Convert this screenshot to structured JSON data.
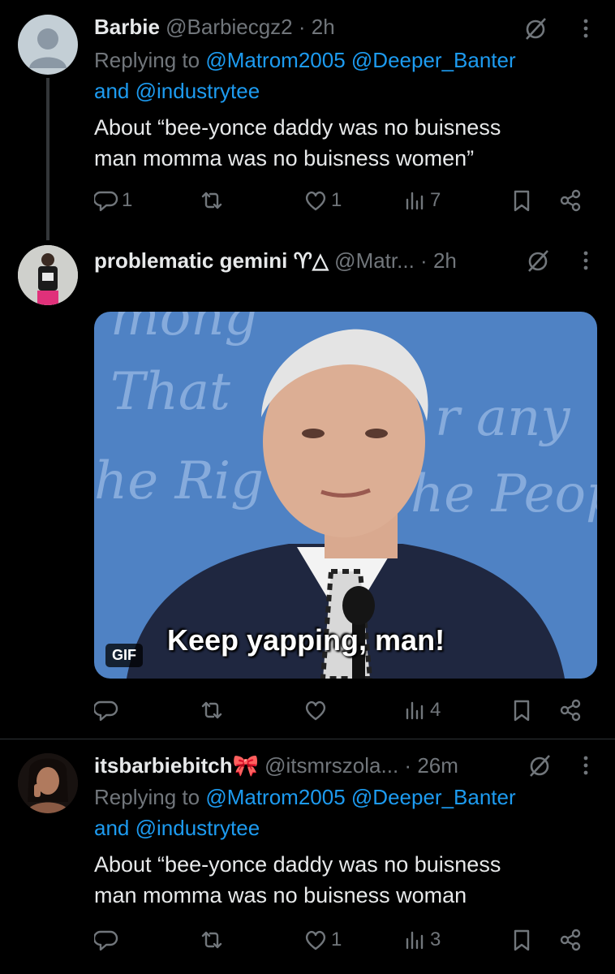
{
  "tweets": [
    {
      "name": "Barbie",
      "handle": "@Barbiecgz2",
      "sep": "·",
      "time": "2h",
      "replying_prefix": "Replying to",
      "reply_user1": "@Matrom2005",
      "reply_user2": "@Deeper_Banter",
      "reply_and": "and",
      "reply_user3": "@industrytee",
      "text_line1": "About “bee-yonce daddy was no buisness",
      "text_line2": "man momma was no buisness women”",
      "replies": "1",
      "retweets": "",
      "likes": "1",
      "views": "7"
    },
    {
      "name": "problematic gemini",
      "name_emoji": "♈︎△",
      "handle": "@Matr...",
      "sep": "·",
      "time": "2h",
      "gif_label": "GIF",
      "gif_caption": "Keep yapping, man!",
      "gif_bg_words": [
        "mong",
        "That",
        "r any",
        "he Rig",
        "he Peop"
      ],
      "replies": "",
      "retweets": "",
      "likes": "",
      "views": "4"
    },
    {
      "name": "itsbarbiebitch",
      "name_emoji": "🎀",
      "handle": "@itsmrszola...",
      "sep": "·",
      "time": "26m",
      "replying_prefix": "Replying to",
      "reply_user1": "@Matrom2005",
      "reply_user2": "@Deeper_Banter",
      "reply_and": "and",
      "reply_user3": "@industrytee",
      "text_line1": "About “bee-yonce daddy was no buisness",
      "text_line2": "man momma was no buisness woman",
      "replies": "",
      "retweets": "",
      "likes": "1",
      "views": "3"
    }
  ],
  "colors": {
    "background": "#000000",
    "text": "#e7e9ea",
    "muted": "#71767b",
    "link": "#1d9bf0",
    "divider": "#2f3336"
  },
  "icons": [
    "reply-icon",
    "retweet-icon",
    "like-icon",
    "views-icon",
    "bookmark-icon",
    "share-icon",
    "grok-icon",
    "more-icon"
  ]
}
